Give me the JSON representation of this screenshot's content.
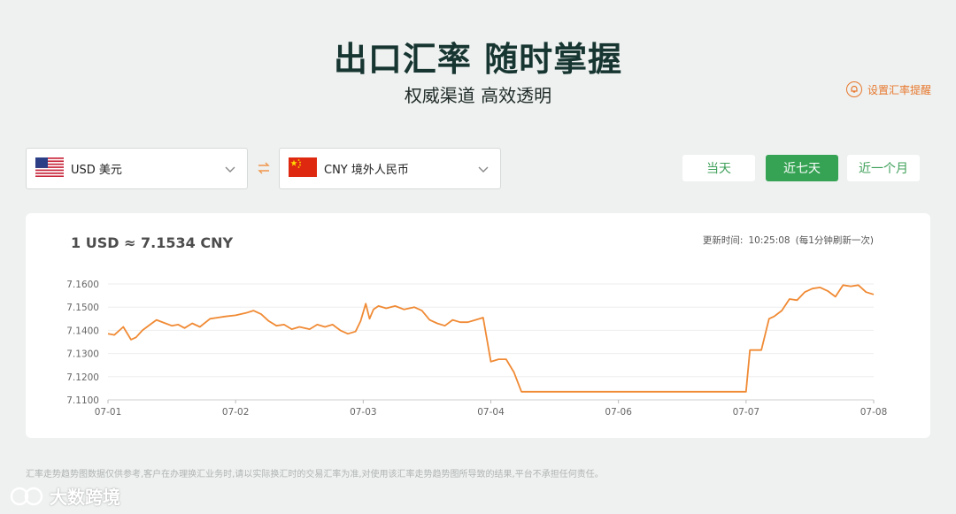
{
  "hero": {
    "title": "出口汇率 随时掌握",
    "subtitle": "权威渠道 高效透明"
  },
  "alert": {
    "label": "设置汇率提醒",
    "icon": "bell-icon"
  },
  "from_currency": {
    "label": "USD 美元",
    "flag": "us-flag-icon"
  },
  "to_currency": {
    "label": "CNY 境外人民币",
    "flag": "cn-flag-icon"
  },
  "ranges": [
    {
      "label": "当天",
      "active": false
    },
    {
      "label": "近七天",
      "active": true
    },
    {
      "label": "近一个月",
      "active": false
    }
  ],
  "card": {
    "rate_text": "1 USD ≈ 7.1534 CNY",
    "update_label": "更新时间:",
    "update_time": "10:25:08",
    "update_note": "(每1分钟刷新一次)"
  },
  "chart_data": {
    "type": "line",
    "title": "",
    "xlabel": "",
    "ylabel": "",
    "ylim": [
      7.11,
      7.16
    ],
    "y_ticks": [
      "7.1600",
      "7.1500",
      "7.1400",
      "7.1300",
      "7.1200",
      "7.1100"
    ],
    "y_tick_values": [
      7.16,
      7.15,
      7.14,
      7.13,
      7.12,
      7.11
    ],
    "x_ticks": [
      "07-01",
      "07-02",
      "07-03",
      "07-04",
      "07-06",
      "07-07",
      "07-08"
    ],
    "x_range": [
      0,
      6
    ],
    "grid": true,
    "color": "#f08a34",
    "series": [
      {
        "x": [
          0,
          0.05,
          0.12,
          0.18,
          0.22,
          0.27,
          0.33,
          0.38,
          0.45,
          0.5,
          0.55,
          0.6,
          0.66,
          0.72,
          0.8,
          0.86,
          0.92,
          1.0,
          1.08,
          1.14,
          1.2,
          1.26,
          1.32,
          1.38,
          1.44,
          1.5,
          1.58,
          1.64,
          1.7,
          1.76,
          1.82,
          1.88,
          1.94,
          1.98,
          2.02,
          2.05,
          2.08,
          2.12,
          2.18,
          2.25,
          2.32,
          2.4,
          2.46,
          2.52,
          2.58,
          2.64,
          2.7,
          2.76,
          2.82,
          2.88,
          2.94,
          3.0,
          3.03,
          3.06,
          3.12,
          3.18,
          3.24,
          3.28,
          3.35,
          5.0,
          5.03,
          5.12,
          5.18,
          5.22,
          5.28,
          5.34,
          5.4,
          5.46,
          5.52,
          5.58,
          5.64,
          5.7,
          5.76,
          5.82,
          5.88,
          5.94,
          6.0
        ],
        "y": [
          7.1385,
          7.138,
          7.1415,
          7.136,
          7.137,
          7.14,
          7.1425,
          7.1445,
          7.143,
          7.142,
          7.1425,
          7.141,
          7.143,
          7.1415,
          7.145,
          7.1455,
          7.146,
          7.1465,
          7.1475,
          7.1485,
          7.147,
          7.144,
          7.142,
          7.1425,
          7.1405,
          7.1415,
          7.1405,
          7.1425,
          7.1415,
          7.1425,
          7.14,
          7.1385,
          7.1395,
          7.144,
          7.1515,
          7.145,
          7.149,
          7.1505,
          7.1495,
          7.1505,
          7.149,
          7.15,
          7.1485,
          7.1445,
          7.143,
          7.142,
          7.1445,
          7.1435,
          7.1435,
          7.1445,
          7.1455,
          7.1265,
          7.127,
          7.1275,
          7.1275,
          7.122,
          7.1135,
          7.1135,
          7.1135,
          7.1135,
          7.1315,
          7.1315,
          7.145,
          7.146,
          7.1485,
          7.1535,
          7.153,
          7.1565,
          7.158,
          7.1585,
          7.157,
          7.1545,
          7.1595,
          7.159,
          7.1595,
          7.1565,
          7.1555
        ]
      }
    ]
  },
  "disclaimer": "汇率走势趋势图数据仅供参考,客户在办理换汇业务时,请以实际换汇时的交易汇率为准,对使用该汇率走势趋势图所导致的结果,平台不承担任何责任。",
  "watermark": "大数跨境"
}
